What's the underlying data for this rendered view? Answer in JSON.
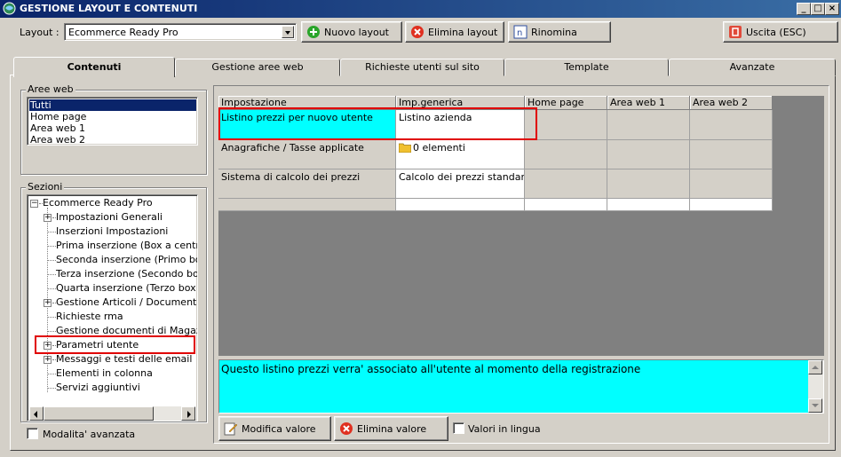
{
  "window": {
    "title": "GESTIONE LAYOUT E CONTENUTI",
    "controls": {
      "minimize": "_",
      "maximize": "□",
      "close": "×"
    }
  },
  "toolbar": {
    "layout_label": "Layout :",
    "layout_value": "Ecommerce Ready Pro",
    "new_layout": "Nuovo layout",
    "delete_layout": "Elimina layout",
    "rename": "Rinomina",
    "exit": "Uscita (ESC)"
  },
  "tabs": [
    {
      "label": "Contenuti",
      "active": true
    },
    {
      "label": "Gestione aree web"
    },
    {
      "label": "Richieste utenti sul sito"
    },
    {
      "label": "Template"
    },
    {
      "label": "Avanzate"
    }
  ],
  "aree_web": {
    "title": "Aree web",
    "items": [
      "Tutti",
      "Home page",
      "Area web 1",
      "Area web 2"
    ],
    "selected": "Tutti"
  },
  "sezioni": {
    "title": "Sezioni",
    "root": "Ecommerce Ready Pro",
    "items": [
      {
        "label": "Impostazioni Generali",
        "expandable": true
      },
      {
        "label": "Inserzioni Impostazioni",
        "expandable": false
      },
      {
        "label": "Prima inserzione (Box a centro pa",
        "expandable": false
      },
      {
        "label": "Seconda inserzione (Primo box in",
        "expandable": false
      },
      {
        "label": "Terza inserzione (Secondo box in",
        "expandable": false
      },
      {
        "label": "Quarta inserzione (Terzo box in ba",
        "expandable": false
      },
      {
        "label": "Gestione Articoli / Documenti",
        "expandable": true
      },
      {
        "label": "Richieste rma",
        "expandable": false
      },
      {
        "label": "Gestione documenti di Magazzino",
        "expandable": false
      },
      {
        "label": "Parametri utente",
        "expandable": true
      },
      {
        "label": "Messaggi e testi delle email",
        "expandable": true
      },
      {
        "label": "Elementi in colonna",
        "expandable": false
      },
      {
        "label": "Servizi aggiuntivi",
        "expandable": false
      }
    ]
  },
  "advanced_mode_label": "Modalita' avanzata",
  "grid": {
    "columns": [
      "Impostazione",
      "Imp.generica",
      "Home page",
      "Area web 1",
      "Area web 2"
    ],
    "rows": [
      {
        "setting": "Listino prezzi per nuovo utente",
        "generic": "Listino azienda"
      },
      {
        "setting": "Anagrafiche / Tasse applicate",
        "generic": "0 elementi"
      },
      {
        "setting": "Sistema di calcolo dei prezzi",
        "generic": "Calcolo dei prezzi standard"
      }
    ]
  },
  "description": "Questo listino prezzi verra' associato all'utente al momento della registrazione",
  "bottom": {
    "edit_value": "Modifica valore",
    "delete_value": "Elimina valore",
    "values_in_language": "Valori in lingua"
  },
  "colors": {
    "title_start": "#0a246a",
    "title_end": "#3a6ea5",
    "face": "#d4d0c8",
    "highlight_cyan": "#00ffff",
    "annotation_red": "#e00000"
  }
}
